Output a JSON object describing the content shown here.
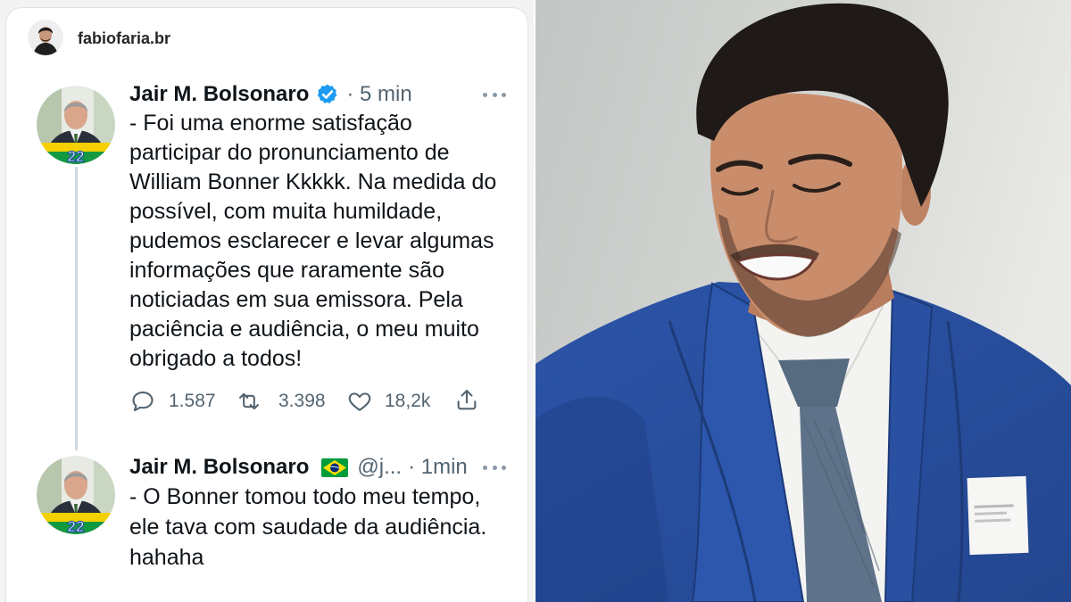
{
  "post": {
    "username": "fabiofaria.br",
    "avatar_icon": "profile-avatar"
  },
  "tweets": [
    {
      "author": "Jair M. Bolsonaro",
      "verified_icon": "verified-badge-icon",
      "time": "· 5 min",
      "avatar_badge": "22",
      "lines": [
        "- Foi uma enorme satisfação",
        "participar do pronunciamento de",
        "William Bonner Kkkkk. Na medida do",
        "possível, com muita humildade,",
        "pudemos esclarecer e levar algumas",
        "informações que raramente são",
        "noticiadas em sua emissora. Pela",
        "paciência e audiência, o meu muito",
        "obrigado a todos!"
      ],
      "replies": "1.587",
      "retweets": "3.398",
      "likes": "18,2k",
      "action_icons": [
        "reply-icon",
        "retweet-icon",
        "heart-icon",
        "share-icon"
      ]
    },
    {
      "author": "Jair M. Bolsonaro",
      "flag_icon": "brazil-flag-icon",
      "handle": "@j...",
      "time": "· 1min",
      "avatar_badge": "22",
      "lines": [
        "- O Bonner tomou todo meu tempo,",
        "ele tava com saudade da audiência.",
        "hahaha"
      ]
    }
  ],
  "colors": {
    "text": "#0f1419",
    "muted": "#536471",
    "verified": "#1d9bf0",
    "thread_line": "#cfd9de",
    "suit": "#2b51a3"
  }
}
